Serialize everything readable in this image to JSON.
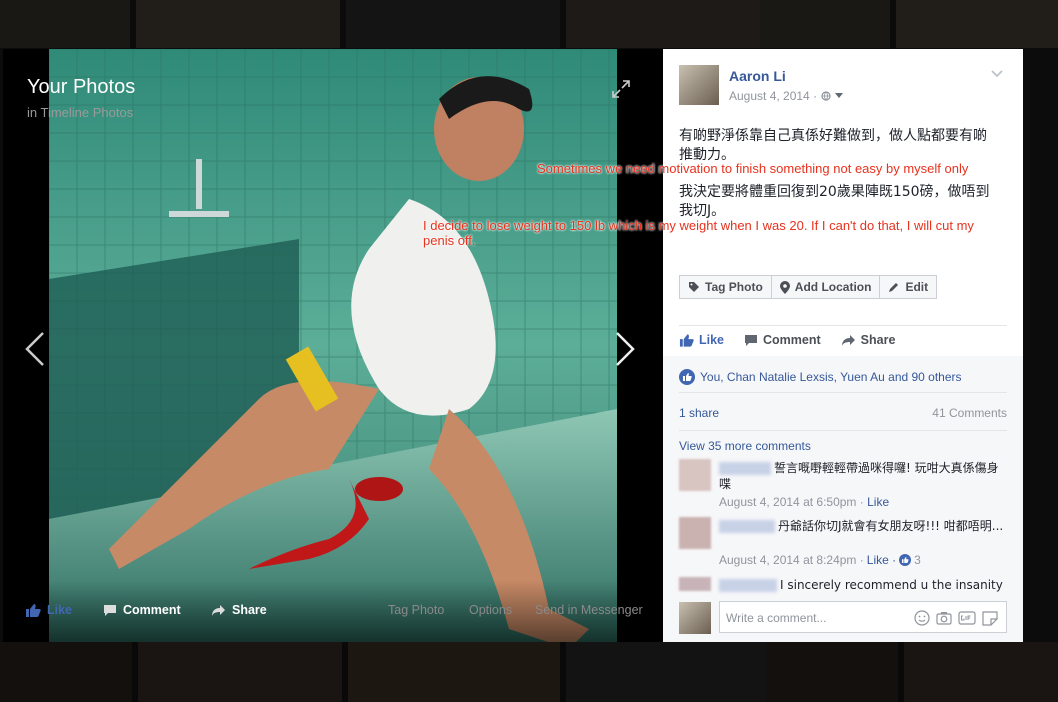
{
  "viewer": {
    "title": "Your Photos",
    "subtitle": "in Timeline Photos",
    "bar": {
      "like": "Like",
      "comment": "Comment",
      "share": "Share",
      "tag": "Tag Photo",
      "options": "Options",
      "send": "Send in Messenger"
    }
  },
  "post": {
    "author": "Aaron Li",
    "date": "August 4, 2014 ·",
    "text1": "有啲野淨係靠自己真係好難做到，做人點都要有啲推動力。",
    "text2": "我決定要將體重回復到20歲果陣既150磅，做唔到我切J。",
    "overlay1": "Sometimes we need motivation to finish something not easy by myself only",
    "overlay2a": "I decide to lose weight to 150 lb which is my weight when I was 20. If I can't do that, I will cut my",
    "overlay2b": "penis off.",
    "actions": {
      "tag": "Tag Photo",
      "location": "Add Location",
      "edit": "Edit"
    }
  },
  "ufi": {
    "like": "Like",
    "comment": "Comment",
    "share": "Share"
  },
  "reactions": {
    "likes_text": "You, Chan Natalie Lexsis, Yuen Au and 90 others",
    "shares": "1 share",
    "comments": "41 Comments"
  },
  "comments": {
    "view_more": "View 35 more comments",
    "items": [
      {
        "text": "誓言嘅嘢輕輕帶過咪得囉! 玩咁大真係傷身喋",
        "time": "August 4, 2014 at 6:50pm ·",
        "like": "Like"
      },
      {
        "text": "丹爺話你切J就會有女朋友呀!!! 咁都唔明...",
        "time": "August 4, 2014 at 8:24pm ·",
        "like": "Like ·",
        "count": "3"
      },
      {
        "text": "I sincerely recommend u the insanity"
      }
    ],
    "composer_placeholder": "Write a comment..."
  },
  "colors": {
    "fb_blue": "#365899",
    "like_blue": "#4267b2",
    "overlay_red": "#e8321e"
  }
}
